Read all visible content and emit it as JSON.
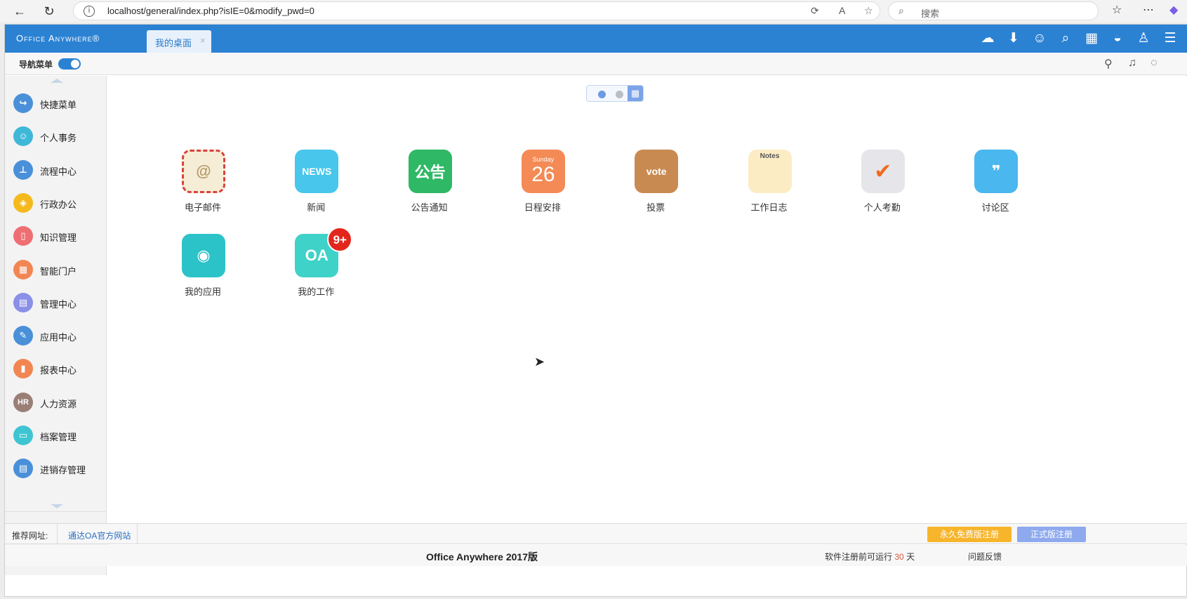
{
  "browser": {
    "url": "localhost/general/index.php?isIE=0&modify_pwd=0",
    "search_placeholder": "搜索"
  },
  "app": {
    "logo": "Office Anywhere®",
    "tab_label": "我的桌面",
    "nav_menu_label": "导航菜单"
  },
  "sidebar": {
    "items": [
      {
        "label": "快捷菜单",
        "icon": "share-arrow-icon",
        "color": "#4a90d9",
        "glyph": "↪"
      },
      {
        "label": "个人事务",
        "icon": "user-icon",
        "color": "#3fb8d8",
        "glyph": "☺"
      },
      {
        "label": "流程中心",
        "icon": "stamp-icon",
        "color": "#4a90d9",
        "glyph": "⊥"
      },
      {
        "label": "行政办公",
        "icon": "layers-icon",
        "color": "#f5b91c",
        "glyph": "◈"
      },
      {
        "label": "知识管理",
        "icon": "book-icon",
        "color": "#ef6e73",
        "glyph": "▯"
      },
      {
        "label": "智能门户",
        "icon": "building-icon",
        "color": "#f28653",
        "glyph": "▦"
      },
      {
        "label": "管理中心",
        "icon": "document-icon",
        "color": "#8a8fe8",
        "glyph": "▤"
      },
      {
        "label": "应用中心",
        "icon": "pen-icon",
        "color": "#4a90d9",
        "glyph": "✎"
      },
      {
        "label": "报表中心",
        "icon": "bar-chart-icon",
        "color": "#f28653",
        "glyph": "▮"
      },
      {
        "label": "人力资源",
        "icon": "hr-icon",
        "color": "#9a7f76",
        "glyph": "HR"
      },
      {
        "label": "档案管理",
        "icon": "archive-box-icon",
        "color": "#3fc5d2",
        "glyph": "▭"
      },
      {
        "label": "进销存管理",
        "icon": "clipboard-icon",
        "color": "#4a90d9",
        "glyph": "▤"
      }
    ]
  },
  "apps": [
    {
      "label": "电子邮件",
      "icon": "email-icon",
      "bg": "#f6edd7",
      "glyph": "@"
    },
    {
      "label": "新闻",
      "icon": "news-icon",
      "bg": "#48c6ec",
      "glyph": "NEWS"
    },
    {
      "label": "公告通知",
      "icon": "notice-board-icon",
      "bg": "#2fb865",
      "glyph": "公告"
    },
    {
      "label": "日程安排",
      "icon": "calendar-day-icon",
      "bg": "#f48a55",
      "glyph": "26",
      "sub": "Sunday"
    },
    {
      "label": "投票",
      "icon": "vote-box-icon",
      "bg": "#c98a52",
      "glyph": "vote"
    },
    {
      "label": "工作日志",
      "icon": "notes-icon",
      "bg": "#fbecc4",
      "glyph": "Notes"
    },
    {
      "label": "个人考勤",
      "icon": "attendance-check-icon",
      "bg": "#e6e6ea",
      "glyph": "✔"
    },
    {
      "label": "讨论区",
      "icon": "quote-bubble-icon",
      "bg": "#4ab7ee",
      "glyph": "❞"
    },
    {
      "label": "我的应用",
      "icon": "my-apps-icon",
      "bg": "#2bc3c8",
      "glyph": "◉"
    },
    {
      "label": "我的工作",
      "icon": "oa-work-icon",
      "bg": "#3fd2c8",
      "glyph": "OA",
      "badge": "9+"
    }
  ],
  "footer": {
    "recommend_label": "推荐网址:",
    "recommend_link": "通达OA官方网站",
    "free_button": "永久免费版注册",
    "reg_button": "正式版注册",
    "product_title": "Office Anywhere 2017版",
    "trial_prefix": "软件注册前可运行",
    "trial_days": "30",
    "trial_suffix": "天",
    "feedback": "问题反馈"
  },
  "colors": {
    "brand": "#2b82d3",
    "free_button": "#f7b52c",
    "reg_button": "#8ea9ee"
  }
}
